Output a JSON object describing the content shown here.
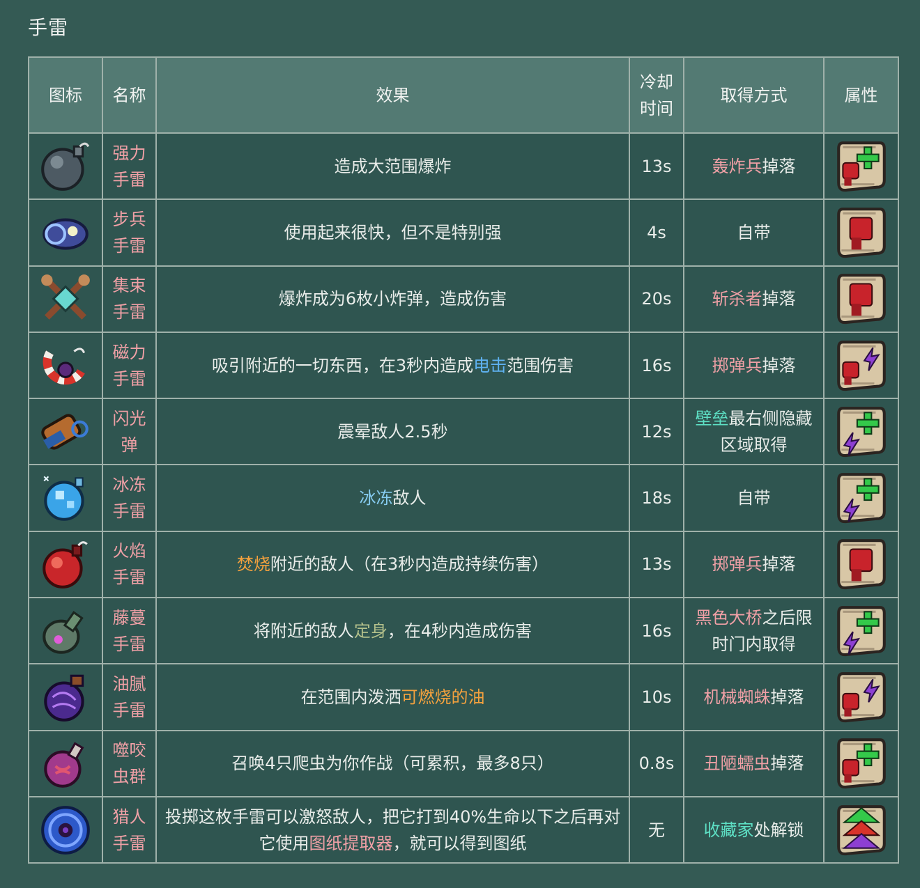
{
  "page": {
    "title": "手雷"
  },
  "table": {
    "headers": [
      {
        "key": "icon",
        "label": "图标"
      },
      {
        "key": "name",
        "label": "名称"
      },
      {
        "key": "effect",
        "label": "效果"
      },
      {
        "key": "cooldown",
        "label": "冷却时间"
      },
      {
        "key": "source",
        "label": "取得方式"
      },
      {
        "key": "attribute",
        "label": "属性"
      }
    ],
    "rows": [
      {
        "icon": "bomb-icon",
        "name": "强力手雷",
        "effect": [
          {
            "text": "造成大范围爆炸",
            "color": "plain"
          }
        ],
        "cooldown": "13s",
        "source": [
          {
            "text": "轰炸兵",
            "color": "pink"
          },
          {
            "text": "掉落",
            "color": "plain"
          }
        ],
        "attribute": "brutality-survival-scroll-icon"
      },
      {
        "icon": "infantry-grenade-icon",
        "name": "步兵手雷",
        "effect": [
          {
            "text": "使用起来很快，但不是特别强",
            "color": "plain"
          }
        ],
        "cooldown": "4s",
        "source": [
          {
            "text": "自带",
            "color": "plain"
          }
        ],
        "attribute": "brutality-scroll-icon"
      },
      {
        "icon": "cluster-grenade-icon",
        "name": "集束手雷",
        "effect": [
          {
            "text": "爆炸成为6枚小炸弹，造成伤害",
            "color": "plain"
          }
        ],
        "cooldown": "20s",
        "source": [
          {
            "text": "斩杀者",
            "color": "pink"
          },
          {
            "text": "掉落",
            "color": "plain"
          }
        ],
        "attribute": "brutality-scroll-icon"
      },
      {
        "icon": "magnet-grenade-icon",
        "name": "磁力手雷",
        "effect": [
          {
            "text": "吸引附近的一切东西，在3秒内造成",
            "color": "plain"
          },
          {
            "text": "电击",
            "color": "blue"
          },
          {
            "text": "范围伤害",
            "color": "plain"
          }
        ],
        "cooldown": "16s",
        "source": [
          {
            "text": "掷弹兵",
            "color": "pink"
          },
          {
            "text": "掉落",
            "color": "plain"
          }
        ],
        "attribute": "brutality-tactics-scroll-icon"
      },
      {
        "icon": "flashbang-icon",
        "name": "闪光弹",
        "effect": [
          {
            "text": "震晕敌人2.5秒",
            "color": "plain"
          }
        ],
        "cooldown": "12s",
        "source": [
          {
            "text": "壁垒",
            "color": "teal"
          },
          {
            "text": "最右侧隐藏区域取得",
            "color": "plain"
          }
        ],
        "attribute": "tactics-survival-scroll-icon"
      },
      {
        "icon": "ice-grenade-icon",
        "name": "冰冻手雷",
        "effect": [
          {
            "text": "冰冻",
            "color": "ice"
          },
          {
            "text": "敌人",
            "color": "plain"
          }
        ],
        "cooldown": "18s",
        "source": [
          {
            "text": "自带",
            "color": "plain"
          }
        ],
        "attribute": "tactics-survival-scroll-icon"
      },
      {
        "icon": "fire-grenade-icon",
        "name": "火焰手雷",
        "effect": [
          {
            "text": "焚烧",
            "color": "orange"
          },
          {
            "text": "附近的敌人（在3秒内造成持续伤害）",
            "color": "plain"
          }
        ],
        "cooldown": "13s",
        "source": [
          {
            "text": "掷弹兵",
            "color": "pink"
          },
          {
            "text": "掉落",
            "color": "plain"
          }
        ],
        "attribute": "brutality-scroll-icon"
      },
      {
        "icon": "vine-grenade-icon",
        "name": "藤蔓手雷",
        "effect": [
          {
            "text": "将附近的敌人",
            "color": "plain"
          },
          {
            "text": "定身",
            "color": "olive"
          },
          {
            "text": "，在4秒内造成伤害",
            "color": "plain"
          }
        ],
        "cooldown": "16s",
        "source": [
          {
            "text": "黑色大桥",
            "color": "pink"
          },
          {
            "text": "之后限时门内取得",
            "color": "plain"
          }
        ],
        "attribute": "tactics-survival-scroll-icon"
      },
      {
        "icon": "oil-grenade-icon",
        "name": "油腻手雷",
        "effect": [
          {
            "text": "在范围内泼洒",
            "color": "plain"
          },
          {
            "text": "可燃烧的油",
            "color": "orange"
          }
        ],
        "cooldown": "10s",
        "source": [
          {
            "text": "机械蜘蛛",
            "color": "pink"
          },
          {
            "text": "掉落",
            "color": "plain"
          }
        ],
        "attribute": "brutality-tactics-scroll-icon"
      },
      {
        "icon": "swarm-grenade-icon",
        "name": "噬咬虫群",
        "effect": [
          {
            "text": "召唤4只爬虫为你作战（可累积，最多8只）",
            "color": "plain"
          }
        ],
        "cooldown": "0.8s",
        "source": [
          {
            "text": "丑陋蠕虫",
            "color": "pink"
          },
          {
            "text": "掉落",
            "color": "plain"
          }
        ],
        "attribute": "brutality-survival-scroll-icon"
      },
      {
        "icon": "hunter-grenade-icon",
        "name": "猎人手雷",
        "effect": [
          {
            "text": "投掷这枚手雷可以激怒敌人，把它打到40%生命以下之后再对它使用",
            "color": "plain"
          },
          {
            "text": "图纸提取器",
            "color": "pink"
          },
          {
            "text": "，就可以得到图纸",
            "color": "plain"
          }
        ],
        "cooldown": "无",
        "source": [
          {
            "text": "收藏家",
            "color": "teal"
          },
          {
            "text": "处解锁",
            "color": "plain"
          }
        ],
        "attribute": "colorless-scroll-icon"
      }
    ]
  },
  "colors": {
    "background": "#345a54",
    "header": "#537a73",
    "cell": "#2f5550",
    "border": "#9fb1aa",
    "pink": "#f0a0a6",
    "blue": "#5fb2f2",
    "ice": "#87cdf2",
    "orange": "#f3a13e",
    "olive": "#b3c08b",
    "teal": "#5ee0c5"
  }
}
